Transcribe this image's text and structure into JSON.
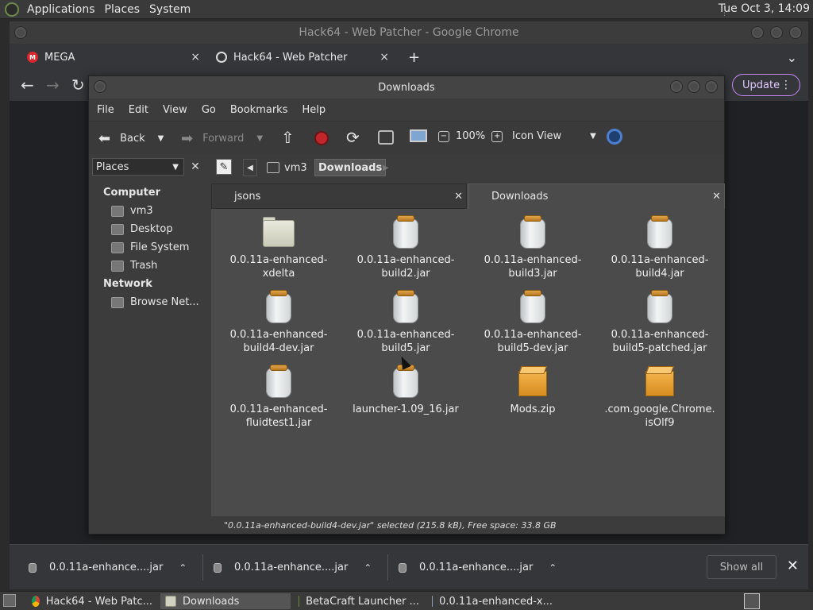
{
  "top_panel": {
    "menus": [
      "Applications",
      "Places",
      "System"
    ],
    "clock": "Tue Oct 3, 14:09"
  },
  "chrome": {
    "title": "Hack64 - Web Patcher - Google Chrome",
    "tabs": [
      {
        "label": "MEGA",
        "close": "×"
      },
      {
        "label": "Hack64 - Web Patcher",
        "close": "×"
      }
    ],
    "new_tab": "+",
    "tab_menu": "⌄",
    "update_label": "Update",
    "update_dots": "⋮",
    "back": "←",
    "forward": "→",
    "reload": "↻"
  },
  "downloads_bar": {
    "items": [
      {
        "label": "0.0.11a-enhance....jar",
        "caret": "⌃"
      },
      {
        "label": "0.0.11a-enhance....jar",
        "caret": "⌃"
      },
      {
        "label": "0.0.11a-enhance....jar",
        "caret": "⌃"
      }
    ],
    "show_all": "Show all",
    "close": "✕"
  },
  "taskbar": {
    "tasks": [
      {
        "label": "Hack64 - Web Patc...",
        "active": false
      },
      {
        "label": "Downloads",
        "active": true
      },
      {
        "label": "BetaCraft Launcher ...",
        "active": false
      },
      {
        "label": "0.0.11a-enhanced-x...",
        "active": false
      }
    ]
  },
  "file_manager": {
    "title": "Downloads",
    "menu": [
      "File",
      "Edit",
      "View",
      "Go",
      "Bookmarks",
      "Help"
    ],
    "toolbar": {
      "back": "Back",
      "forward": "Forward",
      "zoom": "100%",
      "view_mode": "Icon View"
    },
    "places_label": "Places",
    "places_close": "✕",
    "breadcrumb": [
      "vm3",
      "Downloads"
    ],
    "sidebar": {
      "sections": [
        {
          "heading": "Computer",
          "items": [
            "vm3",
            "Desktop",
            "File System",
            "Trash"
          ]
        },
        {
          "heading": "Network",
          "items": [
            "Browse Net..."
          ]
        }
      ]
    },
    "tabs": [
      {
        "label": "jsons",
        "close": "✕"
      },
      {
        "label": "Downloads",
        "close": "✕"
      }
    ],
    "files": [
      {
        "name1": "0.0.11a-enhanced-",
        "name2": "xdelta",
        "icon": "folder-icon"
      },
      {
        "name1": "0.0.11a-enhanced-",
        "name2": "build2.jar",
        "icon": "jar-icon"
      },
      {
        "name1": "0.0.11a-enhanced-",
        "name2": "build3.jar",
        "icon": "jar-icon"
      },
      {
        "name1": "0.0.11a-enhanced-",
        "name2": "build4.jar",
        "icon": "jar-icon"
      },
      {
        "name1": "0.0.11a-enhanced-",
        "name2": "build4-dev.jar",
        "icon": "jar-icon"
      },
      {
        "name1": "0.0.11a-enhanced-",
        "name2": "build5.jar",
        "icon": "jar-icon"
      },
      {
        "name1": "0.0.11a-enhanced-",
        "name2": "build5-dev.jar",
        "icon": "jar-icon"
      },
      {
        "name1": "0.0.11a-enhanced-",
        "name2": "build5-patched.jar",
        "icon": "jar-icon"
      },
      {
        "name1": "0.0.11a-enhanced-",
        "name2": "fluidtest1.jar",
        "icon": "jar-icon"
      },
      {
        "name1": "launcher-1.09_16.jar",
        "name2": "",
        "icon": "jar-icon"
      },
      {
        "name1": "Mods.zip",
        "name2": "",
        "icon": "zip-icon"
      },
      {
        "name1": ".com.google.Chrome.",
        "name2": "isOlf9",
        "icon": "zip-icon"
      }
    ],
    "status": "\"0.0.11a-enhanced-build4-dev.jar\" selected (215.8 kB), Free space: 33.8 GB"
  }
}
